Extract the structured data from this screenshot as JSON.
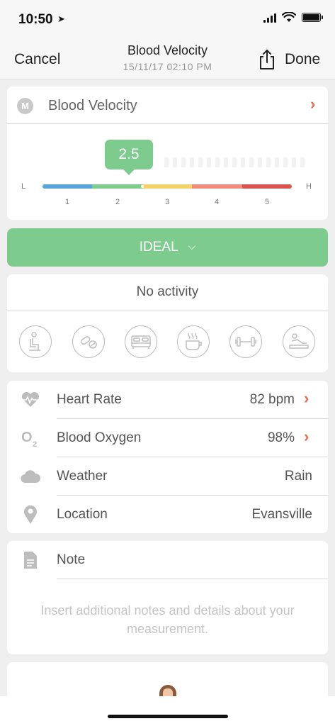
{
  "status": {
    "time": "10:50"
  },
  "nav": {
    "cancel": "Cancel",
    "title": "Blood Velocity",
    "subtitle": "15/11/17 02:10 PM",
    "done": "Done"
  },
  "metric": {
    "badge": "M",
    "name": "Blood Velocity",
    "value": "2.5",
    "level": 2.5,
    "scale_low": "L",
    "scale_high": "H",
    "ticks": [
      "1",
      "2",
      "3",
      "4",
      "5"
    ],
    "segment_colors": [
      "#5aa4dc",
      "#7ecb8e",
      "#f2d36b",
      "#ef8e7c",
      "#d9534f"
    ]
  },
  "status_button": {
    "label": "IDEAL"
  },
  "activity": {
    "title": "No activity",
    "icons": [
      "sitting-icon",
      "pills-icon",
      "bed-icon",
      "coffee-icon",
      "dumbbell-icon",
      "relaxing-icon"
    ]
  },
  "info": [
    {
      "icon": "heart-rate-icon",
      "label": "Heart Rate",
      "value": "82 bpm",
      "has_chevron": true
    },
    {
      "icon": "oxygen-icon",
      "label": "Blood Oxygen",
      "value": "98%",
      "has_chevron": true
    },
    {
      "icon": "cloud-icon",
      "label": "Weather",
      "value": "Rain",
      "has_chevron": false
    },
    {
      "icon": "location-pin-icon",
      "label": "Location",
      "value": "Evansville",
      "has_chevron": false
    }
  ],
  "note": {
    "label": "Note",
    "placeholder": "Insert additional notes and details about your measurement."
  },
  "colors": {
    "accent_green": "#7ecb8e",
    "chevron": "#e36b4f"
  }
}
